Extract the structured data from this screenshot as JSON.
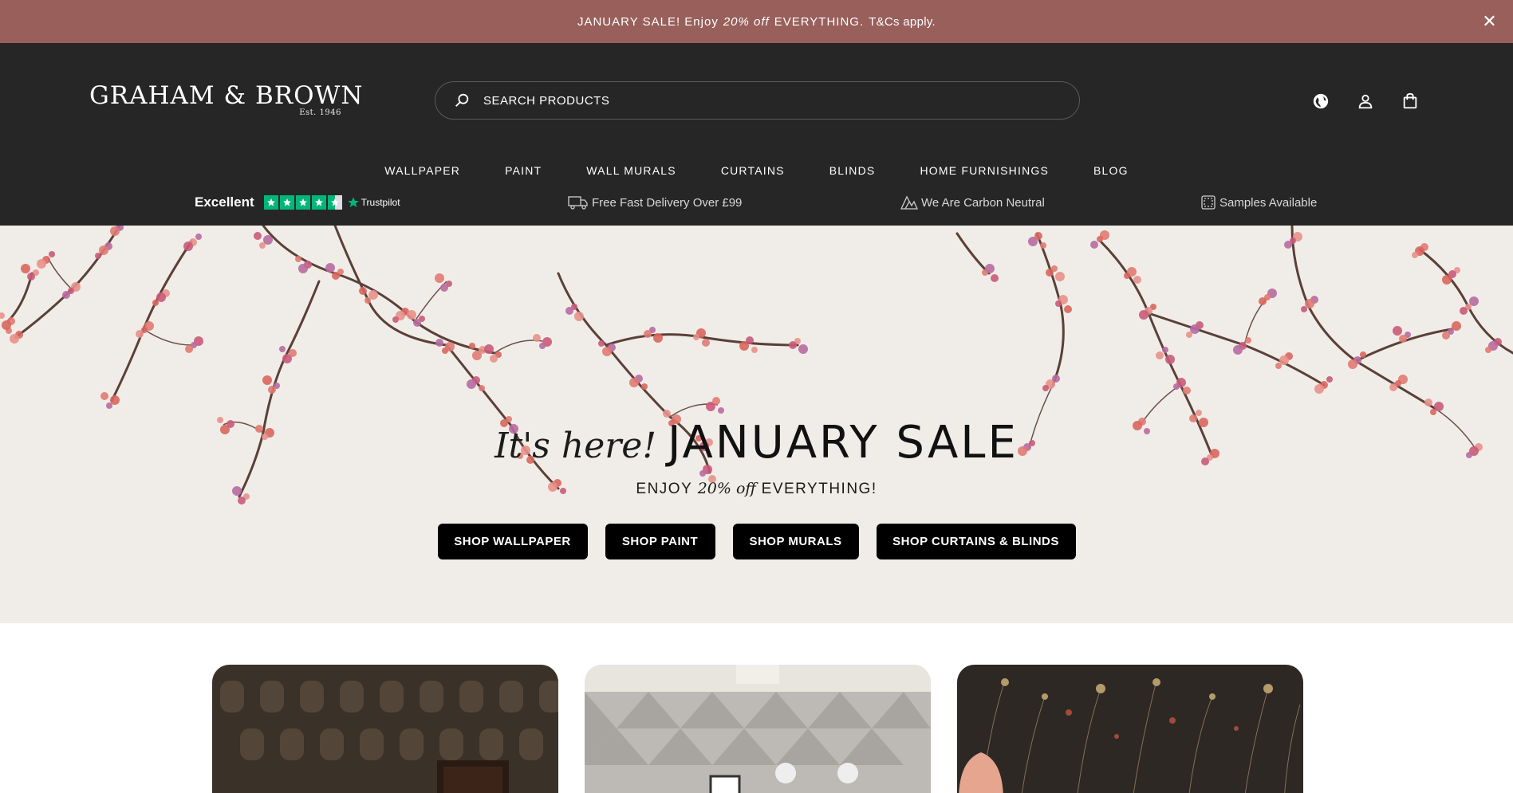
{
  "promo": {
    "text_before": "JANUARY SALE! Enjoy",
    "text_emph": "20% off",
    "text_after": "EVERYTHING.",
    "tc": "T&Cs apply.",
    "close_icon": "close-icon"
  },
  "header": {
    "logo_text": "GRAHAM & BROWN",
    "logo_sub": "Est. 1946",
    "search_placeholder": "SEARCH PRODUCTS",
    "icons": [
      "globe-icon",
      "account-icon",
      "bag-icon"
    ]
  },
  "nav": {
    "items": [
      "WALLPAPER",
      "PAINT",
      "WALL MURALS",
      "CURTAINS",
      "BLINDS",
      "HOME FURNISHINGS",
      "BLOG"
    ]
  },
  "usp": {
    "trustpilot_rating": "Excellent",
    "trustpilot_label": "Trustpilot",
    "trustpilot_stars": 4.5,
    "delivery": "Free Fast Delivery Over £99",
    "carbon": "We Are Carbon Neutral",
    "samples": "Samples Available"
  },
  "hero": {
    "title_italic": "It's here!",
    "title_main": "JANUARY SALE",
    "sub_before": "ENJOY",
    "sub_emph": "20% off",
    "sub_after": "EVERYTHING!",
    "buttons": [
      "SHOP WALLPAPER",
      "SHOP PAINT",
      "SHOP MURALS",
      "SHOP CURTAINS & BLINDS"
    ]
  },
  "colors": {
    "promo_bg": "#985f5b",
    "header_bg": "#262626",
    "hero_bg": "#f0ede8",
    "trustpilot_green": "#00b67a",
    "blossom": "#e07a72"
  }
}
